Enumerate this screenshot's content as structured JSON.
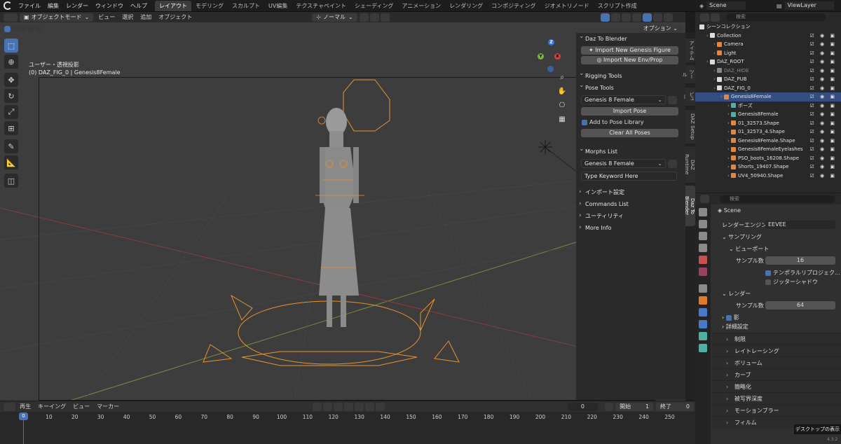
{
  "menu": [
    "ファイル",
    "編集",
    "レンダー",
    "ウィンドウ",
    "ヘルプ"
  ],
  "workspaces": [
    "レイアウト",
    "モデリング",
    "スカルプト",
    "UV編集",
    "テクスチャペイント",
    "シェーディング",
    "アニメーション",
    "レンダリング",
    "コンポジティング",
    "ジオメトリノード",
    "スクリプト作成"
  ],
  "active_workspace": "レイアウト",
  "scene": "Scene",
  "view_layer": "ViewLayer",
  "viewport_header": {
    "mode": "オブジェクトモード",
    "menu": [
      "ビュー",
      "選択",
      "追加",
      "オブジェクト"
    ],
    "orientation": "ノーマル",
    "options": "オプション"
  },
  "viewport": {
    "title": "ユーザー・透視投影",
    "subtitle": "(0) DAZ_FIG_0 | Genesis8Female",
    "gizmo": {
      "x": "X",
      "y": "Y",
      "z": "Z"
    }
  },
  "npanel": {
    "daz_title": "Daz To Blender",
    "import_genesis": "Import New Genesis Figure",
    "import_env": "Import New Env/Prop",
    "rigging": "Rigging Tools",
    "pose_tools": "Pose Tools",
    "pose_figure": "Genesis 8 Female",
    "import_pose": "Import Pose",
    "add_to_library": "Add to Pose Library",
    "clear_poses": "Clear All Poses",
    "morphs_list": "Morphs List",
    "morph_figure": "Genesis 8 Female",
    "keyword": "Type Keyword Here",
    "import_settings": "インポート設定",
    "commands": "Commands List",
    "utility": "ユーティリティ",
    "more_info": "More Info"
  },
  "vtabs": [
    "アイテム",
    "ツール",
    "ビュー",
    "DAZ Setup",
    "DAZ Runtime",
    "Daz To Blender"
  ],
  "outliner": {
    "search_placeholder": "検索",
    "rows": [
      {
        "label": "シーンコレクション",
        "indent": 0,
        "color": "#dcdcdc"
      },
      {
        "label": "Collection",
        "indent": 1,
        "color": "#dcdcdc"
      },
      {
        "label": "Camera",
        "indent": 2,
        "color": "#e8853a"
      },
      {
        "label": "Light",
        "indent": 2,
        "color": "#e8853a"
      },
      {
        "label": "DAZ_ROOT",
        "indent": 1,
        "color": "#dcdcdc"
      },
      {
        "label": "DAZ_HIDE",
        "indent": 2,
        "color": "#888888"
      },
      {
        "label": "DAZ_PUB",
        "indent": 2,
        "color": "#dcdcdc"
      },
      {
        "label": "DAZ_FIG_0",
        "indent": 2,
        "color": "#dcdcdc"
      },
      {
        "label": "Genesis8Female",
        "indent": 3,
        "color": "#e8853a",
        "selected": true
      },
      {
        "label": "ポーズ",
        "indent": 4,
        "color": "#4fb0a5"
      },
      {
        "label": "Genesis8Female",
        "indent": 4,
        "color": "#4fb0a5"
      },
      {
        "label": "01_32573.Shape",
        "indent": 4,
        "color": "#e8853a"
      },
      {
        "label": "01_32573_4.Shape",
        "indent": 4,
        "color": "#e8853a"
      },
      {
        "label": "Genesis8Female.Shape",
        "indent": 4,
        "color": "#e8853a"
      },
      {
        "label": "Genesis8FemaleEyelashes",
        "indent": 4,
        "color": "#e8853a"
      },
      {
        "label": "PSO_boots_16208.Shape",
        "indent": 4,
        "color": "#e8853a"
      },
      {
        "label": "Shorts_19407.Shape",
        "indent": 4,
        "color": "#e8853a"
      },
      {
        "label": "UV4_50940.Shape",
        "indent": 4,
        "color": "#e8853a"
      }
    ]
  },
  "properties": {
    "search_placeholder": "検索",
    "scene_label": "Scene",
    "render_engine_label": "レンダーエンジン",
    "render_engine": "EEVEE",
    "sampling": "サンプリング",
    "viewport": "ビューポート",
    "samples_label": "サンプル数",
    "viewport_samples": "16",
    "temporal": "テンポラルリプロジェク...",
    "jitter": "ジッターシャドウ",
    "render": "レンダー",
    "render_samples": "64",
    "shadow": "影",
    "advanced": "詳細設定",
    "sections": [
      "制限",
      "レイトレーシング",
      "ボリューム",
      "カーブ",
      "簡略化",
      "被写界深度",
      "モーションブラー",
      "フィルム"
    ]
  },
  "timeline": {
    "menu": [
      "再生",
      "キーイング",
      "ビュー",
      "マーカー"
    ],
    "current": "0",
    "start_label": "開始",
    "start": "1",
    "end_label": "終了",
    "end": "0",
    "ticks": [
      "0",
      "10",
      "20",
      "30",
      "40",
      "50",
      "60",
      "70",
      "80",
      "90",
      "100",
      "110",
      "120",
      "130",
      "140",
      "150",
      "160",
      "170",
      "180",
      "190",
      "200",
      "210",
      "220",
      "230",
      "240",
      "250"
    ]
  },
  "tooltip": "デスクトップの表示",
  "version": "4.3.2"
}
